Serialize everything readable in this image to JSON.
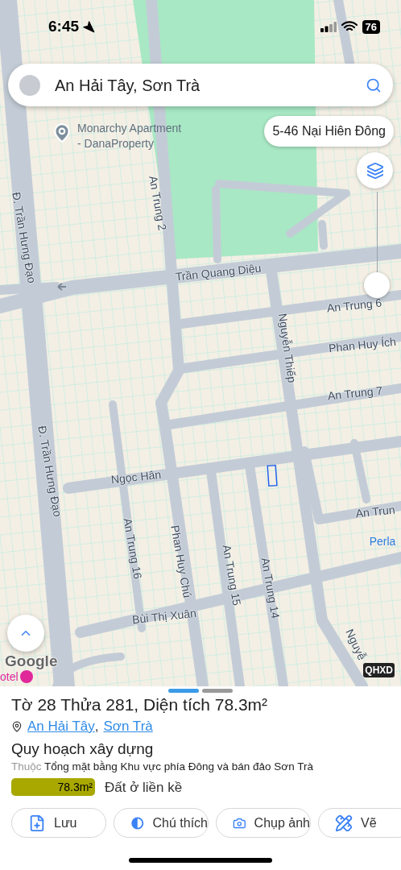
{
  "status_bar": {
    "time": "6:45",
    "battery": "76"
  },
  "search": {
    "value": "An Hải Tây, Sơn Trà"
  },
  "map": {
    "poi": {
      "name": "Monarchy Apartment\n- DanaProperty"
    },
    "address_chip": "5-46 Nại Hiên Đông",
    "tilt_slider": {
      "level": 0
    },
    "labels": [
      {
        "text": "Đ. Trần Hưng Đạo",
        "kind": "street"
      },
      {
        "text": "An Trung 2",
        "kind": "street"
      },
      {
        "text": "Trần Quang Diệu",
        "kind": "street"
      },
      {
        "text": "An Trung 6",
        "kind": "street"
      },
      {
        "text": "Nguyễn Thiếp",
        "kind": "street"
      },
      {
        "text": "Phan Huy Ích",
        "kind": "street"
      },
      {
        "text": "An Trung 7",
        "kind": "street"
      },
      {
        "text": "Đ. Trần Hưng Đạo",
        "kind": "street"
      },
      {
        "text": "Ngọc Hân",
        "kind": "street"
      },
      {
        "text": "An Trun",
        "kind": "street"
      },
      {
        "text": "Perla",
        "kind": "place"
      },
      {
        "text": "An Trung 16",
        "kind": "street"
      },
      {
        "text": "Phan Huy Chú",
        "kind": "street"
      },
      {
        "text": "An Trung 15",
        "kind": "street"
      },
      {
        "text": "An Trung 14",
        "kind": "street"
      },
      {
        "text": "Bùi Thị Xuân",
        "kind": "street"
      },
      {
        "text": "Nguyễ",
        "kind": "street"
      }
    ],
    "hotel_label": "otel",
    "google_logo": "Google",
    "layer_badge": "QHXD"
  },
  "sheet": {
    "pages": [
      {
        "selected": true
      },
      {
        "selected": false
      }
    ],
    "title": "Tờ 28 Thửa 281, Diện tích 78.3m²",
    "location_links": [
      "An Hải Tây",
      "Sơn Trà"
    ],
    "location_separator": ",",
    "section_title": "Quy hoạch xây dựng",
    "belongs_prefix": "Thuộc",
    "belongs_text": "Tổng mặt bằng Khu vực phía Đông và bán đảo Sơn Trà",
    "zones": [
      {
        "area": "78.3m²",
        "label": "Đất ở liền kề",
        "color": "#a8a800"
      }
    ],
    "actions": [
      {
        "label": "Lưu",
        "kind": "save"
      },
      {
        "label": "Chú thích",
        "kind": "legend"
      },
      {
        "label": "Chụp ảnh",
        "kind": "camera"
      },
      {
        "label": "Vẽ",
        "kind": "draw"
      }
    ]
  }
}
